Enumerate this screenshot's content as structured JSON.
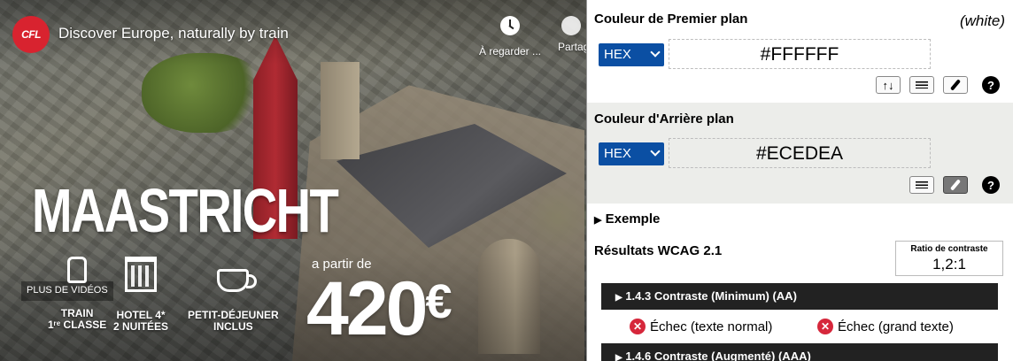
{
  "video": {
    "logo_text": "CFL",
    "title": "Discover Europe, naturally by train",
    "watch_later_label": "À regarder ...",
    "share_label": "Partager",
    "city": "MAASTRICHT",
    "from_label": "a partir de",
    "price": "420",
    "currency": "€",
    "more_videos": "PLUS DE VIDÉOS",
    "features": [
      {
        "icon": "train-icon",
        "line1": "TRAIN",
        "line2": "1ʳᵉ CLASSE"
      },
      {
        "icon": "hotel-icon",
        "line1": "HOTEL 4*",
        "line2": "2 NUITÉES"
      },
      {
        "icon": "cup-icon",
        "line1": "PETIT-DÉJEUNER",
        "line2": "INCLUS"
      }
    ]
  },
  "panel": {
    "foreground": {
      "title": "Couleur de Premier plan",
      "color_name": "(white)",
      "format": "HEX",
      "value": "#FFFFFF",
      "color": "#FFFFFF",
      "swap_glyph": "↑↓",
      "help_glyph": "?"
    },
    "background": {
      "title": "Couleur d'Arrière plan",
      "format": "HEX",
      "value": "#ECEDEA",
      "color": "#ECEDEA",
      "help_glyph": "?"
    },
    "example": {
      "label": "Exemple",
      "arrow": "▶"
    },
    "results": {
      "title": "Résultats WCAG 2.1",
      "ratio_label": "Ratio de contraste",
      "ratio_value": "1,2:1",
      "criteria": [
        {
          "arrow": "▶",
          "label": "1.4.3 Contraste (Minimum) (AA)"
        },
        {
          "arrow": "▶",
          "label": "1.4.6 Contraste (Augmenté) (AAA)"
        }
      ],
      "fail_normal": "Échec (texte normal)",
      "fail_large": "Échec (grand texte)",
      "fail_glyph": "✕",
      "fail_color": "#D6273B"
    }
  }
}
